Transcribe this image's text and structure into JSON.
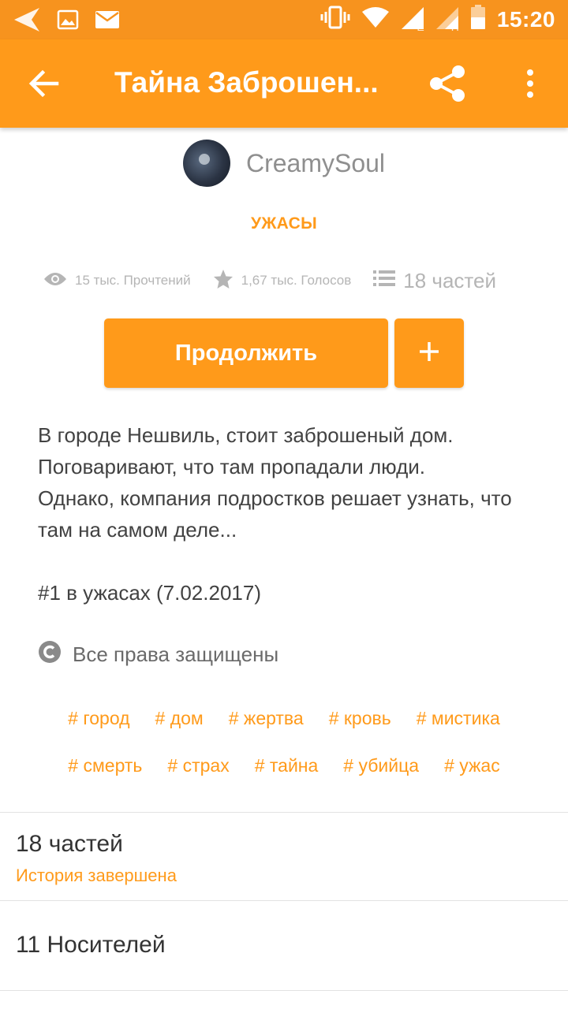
{
  "status_bar": {
    "time": "15:20",
    "sim1_letter": "E",
    "sim2_letter": "H",
    "icons": [
      "navigation-icon",
      "image-icon",
      "mail-icon",
      "vibrate-icon",
      "wifi-icon",
      "signal-icon",
      "signal-icon",
      "battery-icon"
    ]
  },
  "app_bar": {
    "title": "Тайна Заброшен...",
    "icons": [
      "back-arrow-icon",
      "share-icon",
      "more-vert-icon"
    ]
  },
  "story": {
    "author": "CreamySoul",
    "genre": "УЖАСЫ",
    "reads": "15 тыс. Прочтений",
    "votes": "1,67 тыс. Голосов",
    "parts": "18 частей",
    "continue_label": "Продолжить",
    "description": "В городе Нешвиль, стоит заброшеный дом.\nПоговаривают, что там пропадали люди.\nОднако, компания подростков решает узнать, что там на самом деле...\n\n#1 в ужасах (7.02.2017)",
    "copyright": "Все права защищены",
    "tags_row1": [
      "# город",
      "# дом",
      "# жертва",
      "# кровь",
      "# мистика"
    ],
    "tags_row2": [
      "# смерть",
      "# страх",
      "# тайна",
      "# убийца",
      "# ужас"
    ]
  },
  "sections": {
    "parts_title": "18 частей",
    "parts_status": "История завершена",
    "carriers": "11 Носителей"
  },
  "colors": {
    "accent": "#ff9a1a",
    "status_bar": "#f7931e",
    "muted_text": "#b5b5b5"
  }
}
